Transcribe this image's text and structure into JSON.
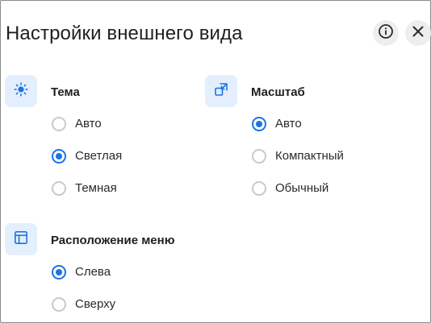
{
  "dialog": {
    "title": "Настройки внешнего вида",
    "info_icon": "info-circle-icon",
    "close_icon": "close-icon"
  },
  "theme": {
    "icon": "sun-icon",
    "title": "Тема",
    "options": [
      {
        "label": "Авто",
        "checked": false
      },
      {
        "label": "Светлая",
        "checked": true
      },
      {
        "label": "Темная",
        "checked": false
      }
    ]
  },
  "scale": {
    "icon": "resize-icon",
    "title": "Масштаб",
    "options": [
      {
        "label": "Авто",
        "checked": true
      },
      {
        "label": "Компактный",
        "checked": false
      },
      {
        "label": "Обычный",
        "checked": false
      }
    ]
  },
  "menu_position": {
    "icon": "layout-icon",
    "title": "Расположение меню",
    "options": [
      {
        "label": "Слева",
        "checked": true
      },
      {
        "label": "Сверху",
        "checked": false
      }
    ]
  },
  "colors": {
    "accent": "#1a73e8",
    "icon_tile_bg": "#e3effd",
    "radio_border": "#c9c9c9"
  }
}
